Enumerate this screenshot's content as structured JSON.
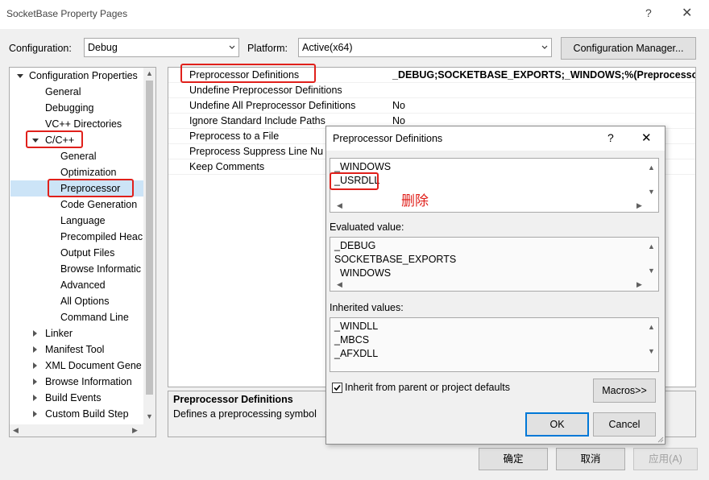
{
  "window": {
    "title": "SocketBase Property Pages",
    "help": "?",
    "close": "✕"
  },
  "toolbar": {
    "configuration_label": "Configuration:",
    "configuration_value": "Debug",
    "platform_label": "Platform:",
    "platform_value": "Active(x64)",
    "config_manager_button": "Configuration Manager..."
  },
  "tree": {
    "items": [
      {
        "label": "Configuration Properties"
      },
      {
        "label": "General"
      },
      {
        "label": "Debugging"
      },
      {
        "label": "VC++ Directories"
      },
      {
        "label": "C/C++"
      },
      {
        "label": "General"
      },
      {
        "label": "Optimization"
      },
      {
        "label": "Preprocessor"
      },
      {
        "label": "Code Generation"
      },
      {
        "label": "Language"
      },
      {
        "label": "Precompiled Heac"
      },
      {
        "label": "Output Files"
      },
      {
        "label": "Browse Informatic"
      },
      {
        "label": "Advanced"
      },
      {
        "label": "All Options"
      },
      {
        "label": "Command Line"
      },
      {
        "label": "Linker"
      },
      {
        "label": "Manifest Tool"
      },
      {
        "label": "XML Document Gene"
      },
      {
        "label": "Browse Information"
      },
      {
        "label": "Build Events"
      },
      {
        "label": "Custom Build Step"
      }
    ]
  },
  "grid": {
    "rows": [
      {
        "name": "Preprocessor Definitions",
        "value": "_DEBUG;SOCKETBASE_EXPORTS;_WINDOWS;%(PreprocessorDe"
      },
      {
        "name": "Undefine Preprocessor Definitions",
        "value": ""
      },
      {
        "name": "Undefine All Preprocessor Definitions",
        "value": "No"
      },
      {
        "name": "Ignore Standard Include Paths",
        "value": "No"
      },
      {
        "name": "Preprocess to a File",
        "value": ""
      },
      {
        "name": "Preprocess Suppress Line Nu",
        "value": ""
      },
      {
        "name": "Keep Comments",
        "value": ""
      }
    ]
  },
  "description": {
    "title": "Preprocessor Definitions",
    "text": "Defines a preprocessing symbol"
  },
  "footer": {
    "ok": "确定",
    "cancel": "取消",
    "apply": "应用(A)"
  },
  "dialog": {
    "title": "Preprocessor Definitions",
    "help": "?",
    "close": "✕",
    "edit_lines": [
      "_WINDOWS",
      "_USRDLL"
    ],
    "annotation": "删除",
    "evaluated_label": "Evaluated value:",
    "evaluated_lines": [
      "_DEBUG",
      "SOCKETBASE_EXPORTS",
      "_WINDOWS"
    ],
    "inherited_label": "Inherited values:",
    "inherited_lines": [
      "_WINDLL",
      "_MBCS",
      "_AFXDLL"
    ],
    "inherit_checkbox_label": "Inherit from parent or project defaults",
    "inherit_checked": true,
    "macros_button": "Macros>>",
    "ok_button": "OK",
    "cancel_button": "Cancel"
  },
  "colors": {
    "annotation_red": "#e0201b",
    "selection": "#cce4f7",
    "focus_blue": "#0078d7"
  }
}
